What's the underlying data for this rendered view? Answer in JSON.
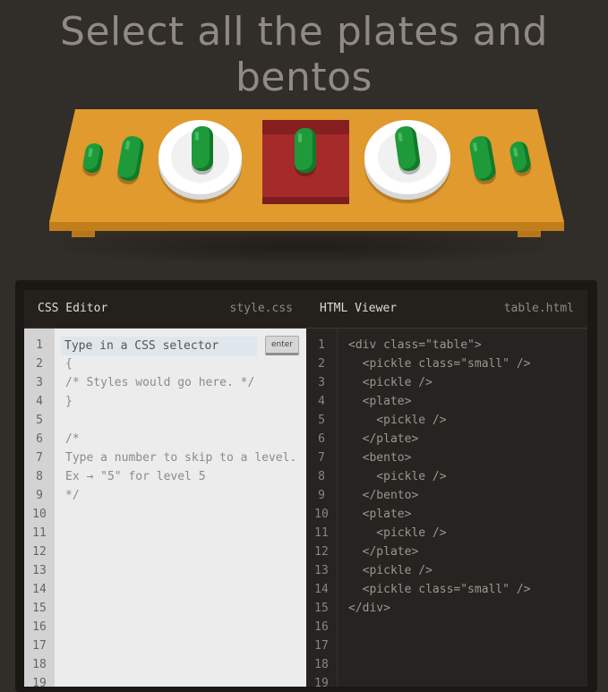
{
  "instruction": "Select all the plates and bentos",
  "colors": {
    "background": "#312d28",
    "table": "#e09a2d",
    "pickle": "#1e9a3a",
    "plate": "#ffffff",
    "bento": "#a52a2a"
  },
  "css_editor": {
    "title": "CSS Editor",
    "filename": "style.css",
    "input_placeholder": "Type in a CSS selector",
    "enter_label": "enter",
    "lines": [
      "",
      "{",
      "/* Styles would go here. */",
      "}",
      "",
      "/*",
      "Type a number to skip to a level.",
      "Ex → \"5\" for level 5",
      "*/",
      "",
      "",
      "",
      "",
      "",
      "",
      "",
      "",
      "",
      ""
    ],
    "line_numbers": [
      "1",
      "2",
      "3",
      "4",
      "5",
      "6",
      "7",
      "8",
      "9",
      "10",
      "11",
      "12",
      "13",
      "14",
      "15",
      "16",
      "17",
      "18",
      "19"
    ]
  },
  "html_viewer": {
    "title": "HTML Viewer",
    "filename": "table.html",
    "lines": [
      "<div class=\"table\">",
      "  <pickle class=\"small\" />",
      "  <pickle />",
      "  <plate>",
      "    <pickle />",
      "  </plate>",
      "  <bento>",
      "    <pickle />",
      "  </bento>",
      "  <plate>",
      "    <pickle />",
      "  </plate>",
      "  <pickle />",
      "  <pickle class=\"small\" />",
      "</div>",
      "",
      "",
      "",
      ""
    ],
    "line_numbers": [
      "1",
      "2",
      "3",
      "4",
      "5",
      "6",
      "7",
      "8",
      "9",
      "10",
      "11",
      "12",
      "13",
      "14",
      "15",
      "16",
      "17",
      "18",
      "19"
    ]
  }
}
